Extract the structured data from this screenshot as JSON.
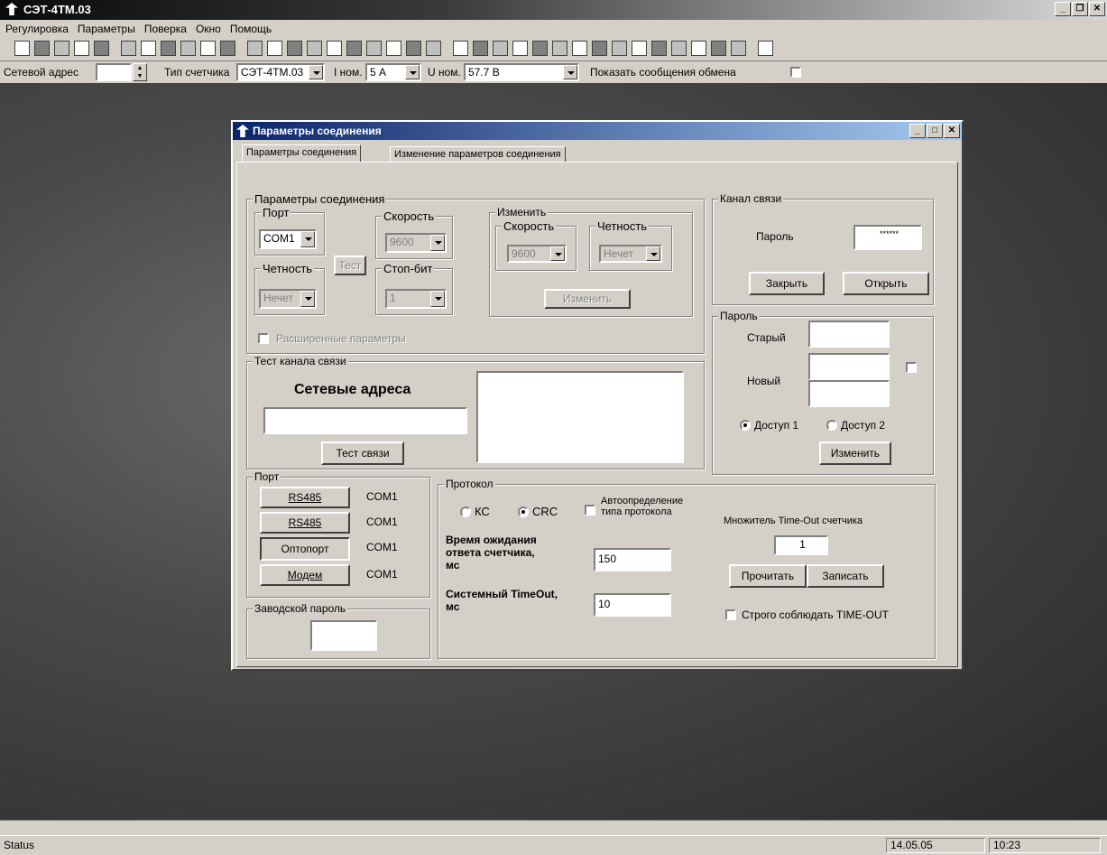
{
  "window": {
    "title": "СЭТ-4ТМ.03"
  },
  "menu": [
    "Регулировка",
    "Параметры",
    "Поверка",
    "Окно",
    "Помощь"
  ],
  "params_bar": {
    "net_address_label": "Сетевой адрес",
    "meter_type_label": "Тип счетчика",
    "meter_type_value": "СЭТ-4ТМ.03",
    "inom_label": "I ном.",
    "inom_value": "5 А",
    "unom_label": "U ном.",
    "unom_value": "57.7 В",
    "show_exchange_label": "Показать сообщения обмена"
  },
  "dialog": {
    "title": "Параметры соединения",
    "tabs": [
      "Параметры соединения",
      "Изменение параметров соединения"
    ],
    "conn_params": {
      "group_label": "Параметры соединения",
      "port_label": "Порт",
      "port_value": "COM1",
      "speed_label": "Скорость",
      "speed_value": "9600",
      "parity_label": "Четность",
      "parity_value": "Нечет",
      "stopbit_label": "Стоп-бит",
      "stopbit_value": "1",
      "test_button": "Тест",
      "extended_label": "Расширенные параметры",
      "change_group_label": "Изменить",
      "change_speed_label": "Скорость",
      "change_speed_value": "9600",
      "change_parity_label": "Четность",
      "change_parity_value": "Нечет",
      "change_button": "Изменить"
    },
    "channel": {
      "group_label": "Канал связи",
      "password_label": "Пароль",
      "password_value": "******",
      "close_button": "Закрыть",
      "open_button": "Открыть"
    },
    "password": {
      "group_label": "Пароль",
      "old_label": "Старый",
      "new_label": "Новый",
      "access1_label": "Доступ 1",
      "access2_label": "Доступ 2",
      "change_button": "Изменить"
    },
    "test_channel": {
      "group_label": "Тест канала связи",
      "net_addresses_label": "Сетевые адреса",
      "test_button": "Тест связи"
    },
    "ports": {
      "group_label": "Порт",
      "rows": [
        {
          "button": "RS485",
          "port": "COM1"
        },
        {
          "button": "RS485",
          "port": "COM1"
        },
        {
          "button": "Оптопорт",
          "port": "COM1"
        },
        {
          "button": "Модем",
          "port": "COM1"
        }
      ]
    },
    "factory_password": {
      "group_label": "Заводской пароль"
    },
    "protocol": {
      "group_label": "Протокол",
      "ks_label": "КС",
      "crc_label": "CRC",
      "auto_detect_line1": "Автоопределение",
      "auto_detect_line2": "типа протокола",
      "wait_label_line1": "Время ожидания",
      "wait_label_line2": "ответа счетчика,",
      "wait_label_line3": "мс",
      "wait_value": "150",
      "sys_timeout_line1": "Системный TimeOut,",
      "sys_timeout_line2": "мс",
      "sys_timeout_value": "10",
      "multiplier_label": "Множитель Time-Out счетчика",
      "multiplier_value": "1",
      "read_button": "Прочитать",
      "write_button": "Записать",
      "strict_label": "Строго соблюдать TIME-OUT"
    }
  },
  "status": {
    "text": "Status",
    "date": "14.05.05",
    "time": "10:23"
  }
}
